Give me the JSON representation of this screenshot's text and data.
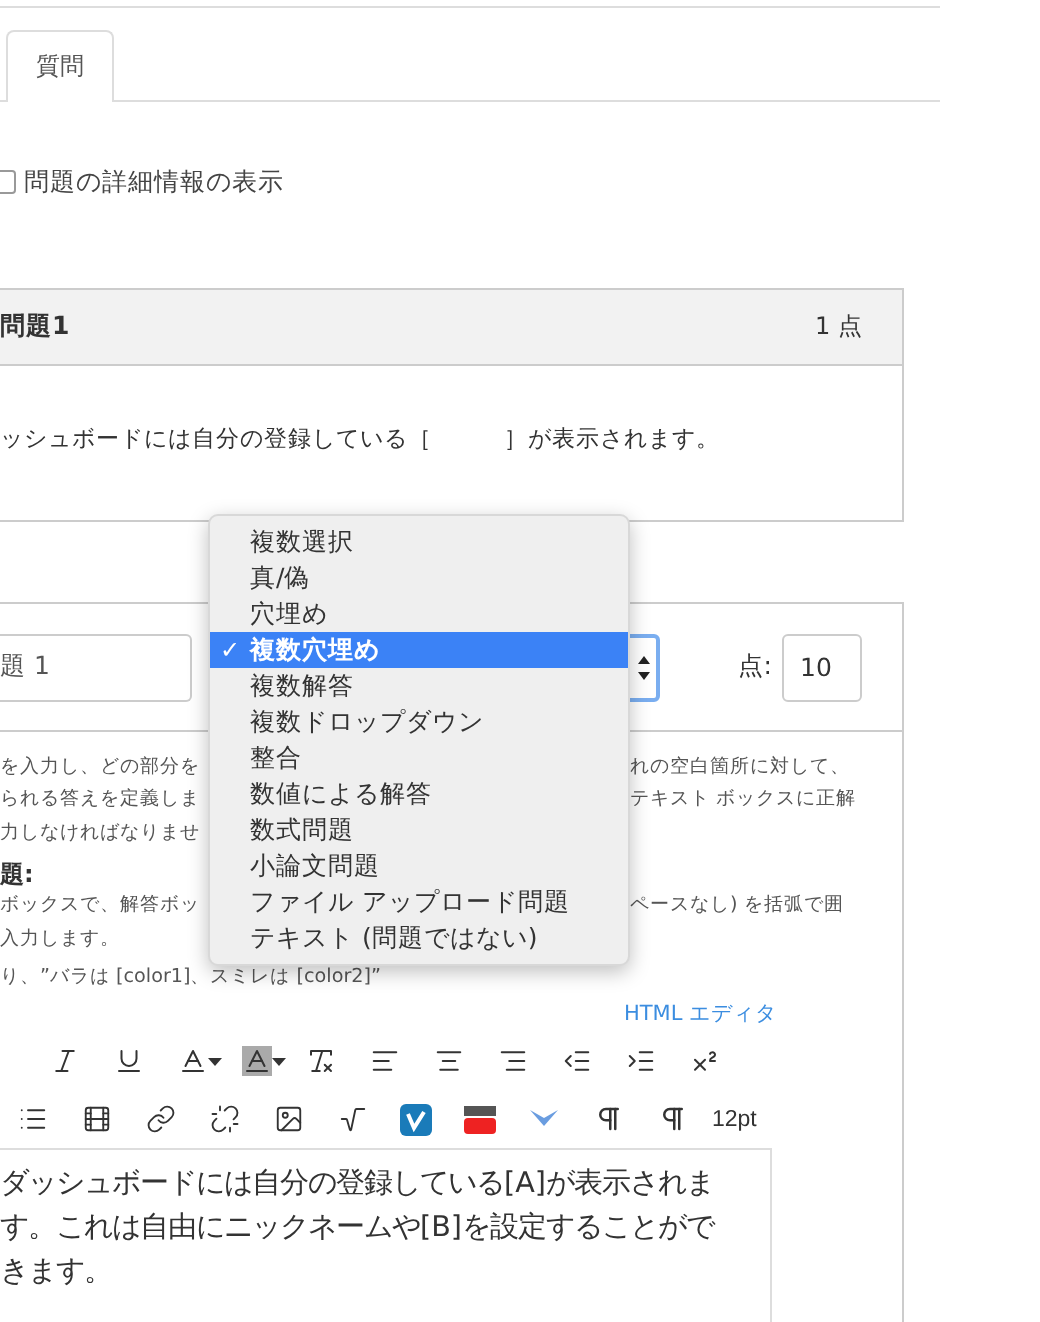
{
  "tabs": [
    {
      "label": "質問",
      "selected": true
    }
  ],
  "details_checkbox": {
    "label": "問題の詳細情報の表示",
    "checked": false
  },
  "question_card": {
    "title": "問題1",
    "points": "1 点",
    "text": "ッシュボードには自分の登録している［　　　］が表示されます。"
  },
  "editor": {
    "title_value": "題 1",
    "points_label": "点:",
    "points_value": "10",
    "type_options": [
      {
        "label": "複数選択",
        "selected": false
      },
      {
        "label": "真/偽",
        "selected": false
      },
      {
        "label": "穴埋め",
        "selected": false
      },
      {
        "label": "複数穴埋め",
        "selected": true
      },
      {
        "label": "複数解答",
        "selected": false
      },
      {
        "label": "複数ドロップダウン",
        "selected": false
      },
      {
        "label": "整合",
        "selected": false
      },
      {
        "label": "数値による解答",
        "selected": false
      },
      {
        "label": "数式問題",
        "selected": false
      },
      {
        "label": "小論文問題",
        "selected": false
      },
      {
        "label": "ファイル アップロード問題",
        "selected": false
      },
      {
        "label": "テキスト (問題ではない)",
        "selected": false
      }
    ],
    "check_mark": "✓",
    "help_lines": [
      {
        "left": "を入力し、どの部分を",
        "right": "れの空白箇所に対して、"
      },
      {
        "left": "られる答えを定義しま",
        "right": "テキスト ボックスに正解"
      },
      {
        "left": "力しなければなりませ"
      }
    ],
    "example_heading": "題:",
    "example_lines": [
      {
        "left": "ボックスで、解答ボッ",
        "right": "ペースなし) を括弧で囲"
      },
      {
        "left": "入力します。"
      },
      {
        "left": "り、”バラは [color1]、スミレは [color2]”"
      }
    ],
    "html_editor_link": "HTML エディタ",
    "font_size": "12pt",
    "content": "ダッシュボードには自分の登録している[A]が表示されます。これは自由にニックネームや[B]を設定することができます。"
  }
}
